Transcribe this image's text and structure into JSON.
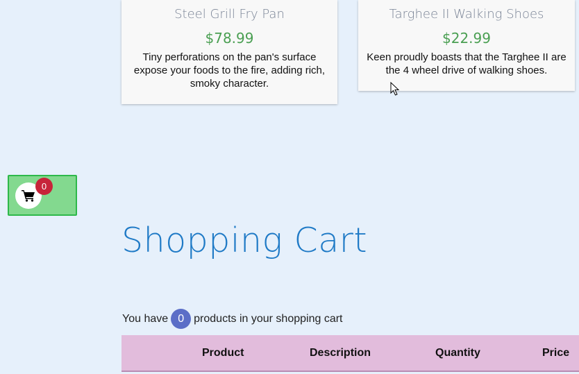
{
  "products": [
    {
      "title": "Steel Grill Fry Pan",
      "price": "$78.99",
      "description": "Tiny perforations on the pan's surface expose your foods to the fire, adding rich, smoky character."
    },
    {
      "title": "Targhee II Walking Shoes",
      "price": "$22.99",
      "description": "Keen proudly boasts that the Targhee II are the 4 wheel drive of walking shoes."
    }
  ],
  "cart_widget": {
    "icon": "shopping-cart-icon",
    "badge_count": "0"
  },
  "cart_section": {
    "heading": "Shopping Cart",
    "summary_prefix": "You have",
    "count": "0",
    "summary_suffix": "products in your shopping cart"
  },
  "table": {
    "columns": [
      "Product",
      "Description",
      "Quantity",
      "Price"
    ]
  },
  "colors": {
    "background": "#e6f0fb",
    "price_green": "#4a9f52",
    "heading_blue": "#1f7ac6",
    "cart_widget_green": "#83d98f",
    "badge_red": "#c7243a",
    "count_badge_blue": "#5b6ec7",
    "table_header_pink": "#e2bcdc"
  }
}
